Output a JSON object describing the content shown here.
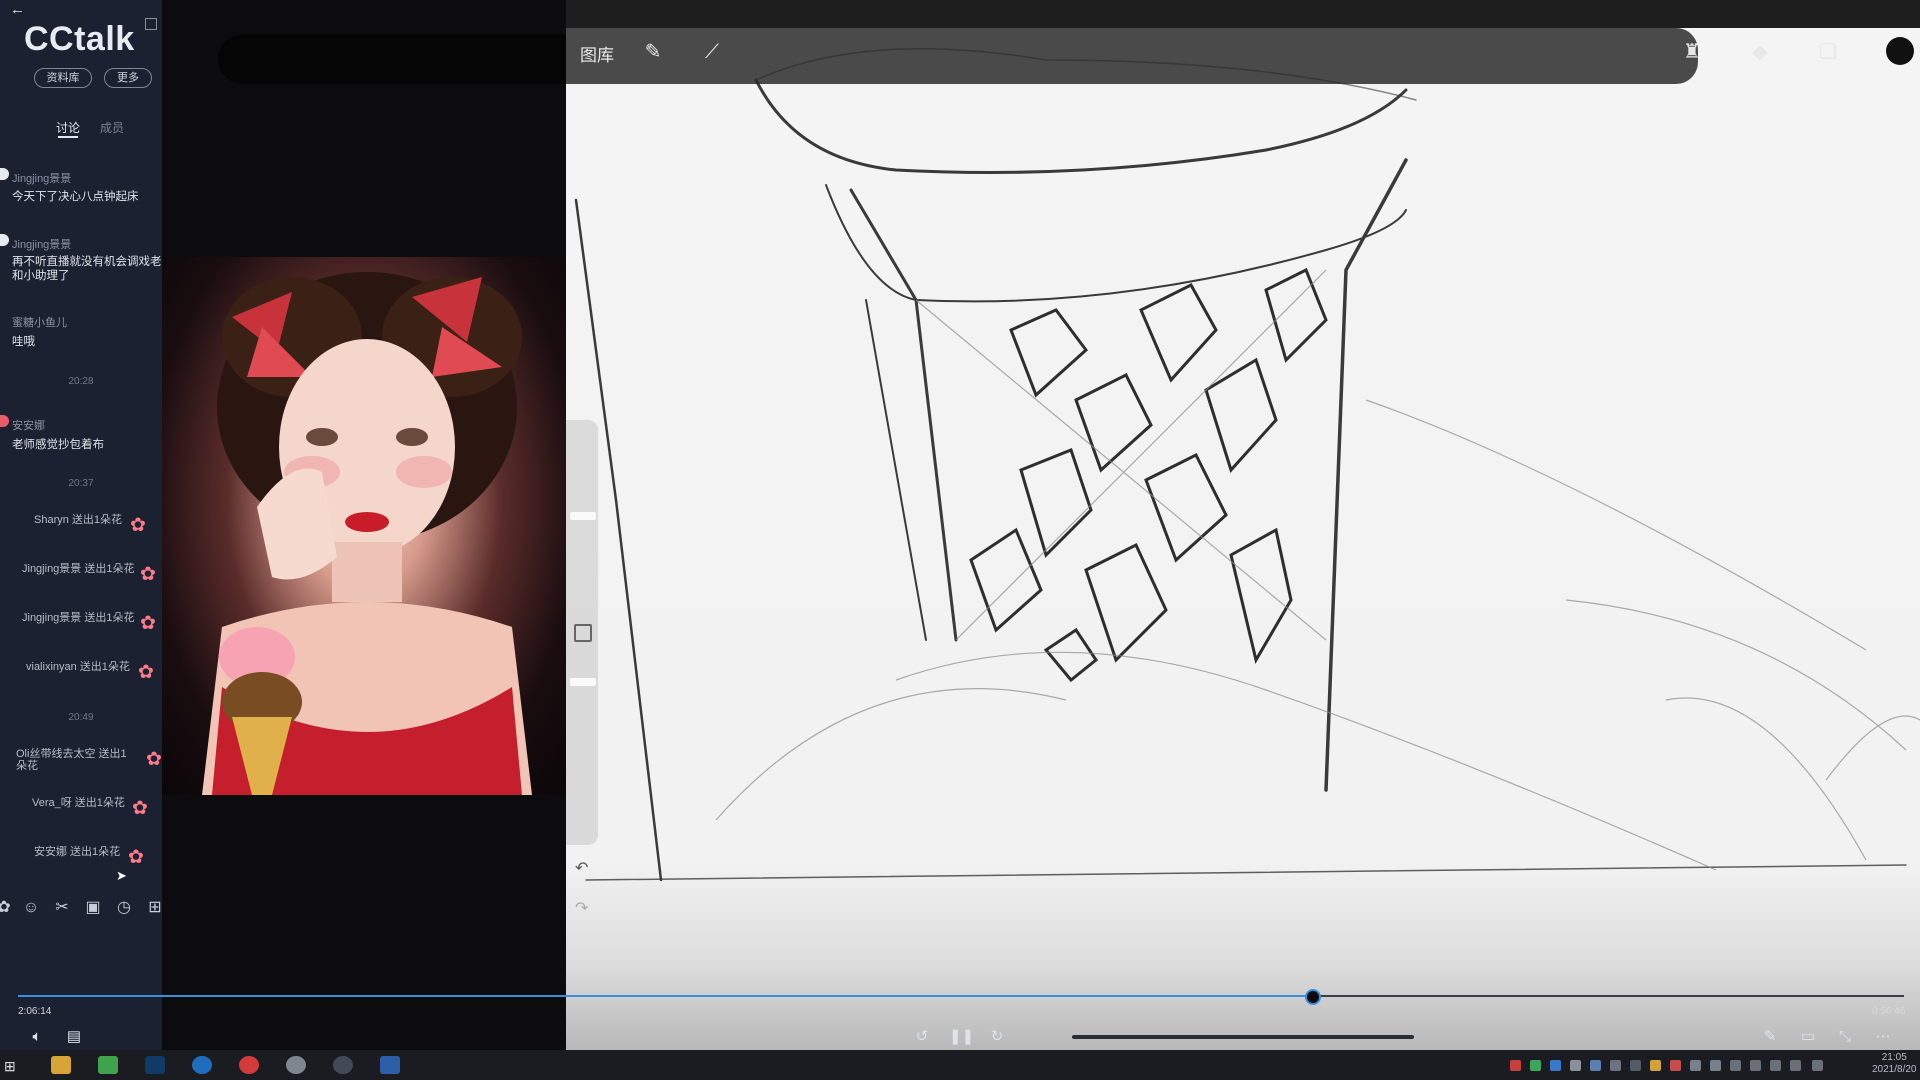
{
  "app": {
    "name": "CCtalk",
    "library_btn": "资料库",
    "more_btn": "更多",
    "tabs": [
      "讨论",
      "成员"
    ]
  },
  "chat": {
    "messages": [
      {
        "user": "Jingjing景景",
        "text": "今天下了决心八点钟起床"
      },
      {
        "user": "Jingjing景景",
        "text": "再不听直播就没有机会调戏老和小助理了"
      },
      {
        "user": "蜜糖小鱼儿",
        "text": "哇哦"
      }
    ],
    "time1": "20:28",
    "message4": {
      "user": "安安娜",
      "text": "老师感觉抄包着布"
    },
    "time2": "20:37",
    "gifts_a": [
      "Sharyn 送出1朵花",
      "Jingjing景景 送出1朵花",
      "Jingjing景景 送出1朵花",
      "vialixinyan 送出1朵花"
    ],
    "time3": "20:49",
    "gifts_b": [
      "Oli丝带线去太空 送出1朵花",
      "Vera_呀 送出1朵花",
      "安安娜 送出1朵花"
    ]
  },
  "toolbar_icons": [
    "gift-icon",
    "emoji-icon",
    "scissors-icon",
    "image-icon",
    "clock-icon",
    "more-icon"
  ],
  "drawing_app": {
    "gallery": "图库",
    "icons": [
      "wrench-icon",
      "magic-wand-icon",
      "brush-icon",
      "smudge-icon",
      "eraser-icon",
      "layers-icon",
      "color-icon"
    ]
  },
  "player": {
    "current_time": "2:06:14",
    "total_time": "0:56:46",
    "progress_fraction": 0.686,
    "controls": [
      "rewind-10-icon",
      "pause-icon",
      "forward-30-icon"
    ]
  },
  "taskbar": {
    "clock_time": "21:05",
    "clock_date": "2021/8/20"
  },
  "colors": {
    "sidebar_bg": "#1b2130",
    "accent_blue": "#3b8de0",
    "flower_pink": "#ff7b8a",
    "canvas_bg": "#f2f2f2"
  }
}
